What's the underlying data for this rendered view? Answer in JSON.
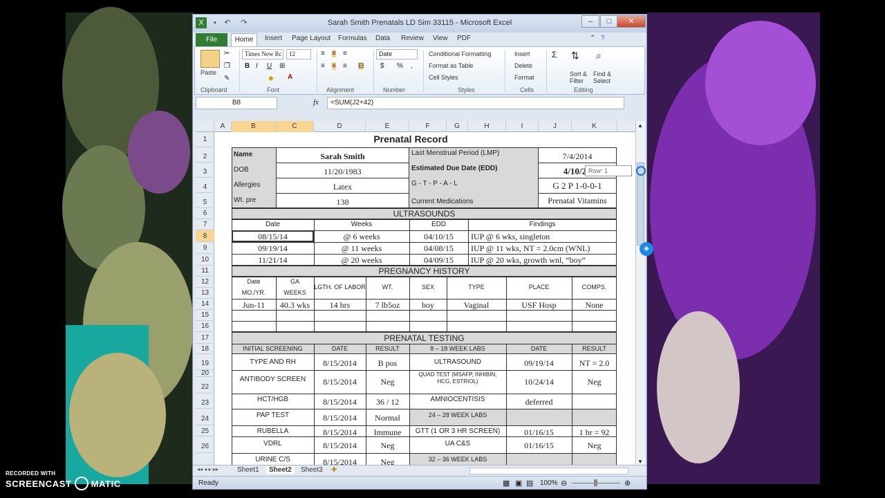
{
  "window": {
    "title": "Sarah Smith Prenatals LD Sim 33115  -  Microsoft Excel"
  },
  "tabs": [
    "File",
    "Home",
    "Insert",
    "Page Layout",
    "Formulas",
    "Data",
    "Review",
    "View",
    "PDF"
  ],
  "ribbon": {
    "clipboard": {
      "paste": "Paste",
      "group": "Clipboard"
    },
    "font": {
      "name": "Times New Rc",
      "size": "12",
      "group": "Font",
      "bold": "B",
      "italic": "I",
      "underline": "U"
    },
    "alignment": {
      "group": "Alignment"
    },
    "number": {
      "format": "Date",
      "currency": "$",
      "percent": "%",
      "comma": ",",
      "group": "Number"
    },
    "styles": {
      "conditional": "Conditional Formatting",
      "table": "Format as Table",
      "cell": "Cell Styles",
      "group": "Styles"
    },
    "cells": {
      "insert": "Insert",
      "delete": "Delete",
      "format": "Format",
      "group": "Cells"
    },
    "editing": {
      "sigma": "Σ",
      "sort1": "Sort &",
      "sort2": "Filter",
      "find1": "Find &",
      "find2": "Select",
      "group": "Editing"
    }
  },
  "formula_bar": {
    "name_box": "B8",
    "fx": "fx",
    "formula": "=SUM(J2+42)"
  },
  "columns": [
    "A",
    "B",
    "C",
    "D",
    "E",
    "F",
    "G",
    "H",
    "I",
    "J",
    "K"
  ],
  "rows": [
    "1",
    "2",
    "3",
    "4",
    "5",
    "6",
    "7",
    "8",
    "9",
    "10",
    "11",
    "12",
    "13",
    "14",
    "15",
    "16",
    "17",
    "18",
    "19",
    "20",
    "22",
    "23",
    "24",
    "25",
    "26"
  ],
  "sheet": {
    "title": "Prenatal Record",
    "name_label": "Name",
    "name_value": "Sarah Smith",
    "dob_label": "DOB",
    "dob_value": "11/20/1983",
    "allergies_label": "Allergies",
    "allergies_value": "Latex",
    "wt_label": "Wt. pre",
    "wt_value": "138",
    "lmp_label": "Last Menstrual Period  (LMP)",
    "lmp_value": "7/4/2014",
    "edd_label": "Estimated Due Date (EDD)",
    "edd_value": "4/10/2",
    "gtpal_label": "G - T - P - A - L",
    "gtpal_value": "G 2 P 1-0-0-1",
    "meds_label": "Current Medications",
    "meds_value": "Prenatal Vitamins",
    "ultrasounds": {
      "header": "ULTRASOUNDS",
      "columns": [
        "Date",
        "Weeks",
        "EDD",
        "Findings"
      ],
      "rows": [
        [
          "08/15/14",
          "@ 6 weeks",
          "04/10/15",
          "IUP @ 6 wks, singleton"
        ],
        [
          "09/19/14",
          "@ 11 weeks",
          "04/08/15",
          "IUP @ 11 wks, NT = 2.0cm (WNL)"
        ],
        [
          "11/21/14",
          "@ 20 weeks",
          "04/09/15",
          "IUP @ 20 wks, growth wnl, “boy”"
        ]
      ]
    },
    "pregnancy_history": {
      "header": "PREGNANCY HISTORY",
      "date_label1": "Date",
      "date_label2": "MO./YR.",
      "ga_label1": "GA",
      "ga_label2": "WEEKS",
      "labor_label": "LGTH. OF LABOR",
      "wt_label": "WT.",
      "sex_label": "SEX",
      "type_label": "TYPE",
      "place_label": "PLACE",
      "comps_label": "COMPS.",
      "row": [
        "Jun-11",
        "40.3 wks",
        "14 hrs",
        "7 lb5oz",
        "boy",
        "Vaginal",
        "USF Hosp",
        "None"
      ]
    },
    "prenatal_testing": {
      "header": "PRENATAL TESTING",
      "columns": [
        "INITIAL SCREENING",
        "DATE",
        "RESULT",
        "8 – 18 WEEK LABS",
        "DATE",
        "RESULT"
      ],
      "rows": [
        [
          "TYPE AND RH",
          "8/15/2014",
          "B pos",
          "ULTRASOUND",
          "09/19/14",
          "NT = 2.0"
        ],
        [
          "ANTIBODY SCREEN",
          "8/15/2014",
          "Neg",
          "QUAD TEST (MSAFP, INHIBIN, HCG, ESTRIOL)",
          "10/24/14",
          "Neg"
        ],
        [
          "HCT/HGB",
          "8/15/2014",
          "36 / 12",
          "AMNIOCENTISIS",
          "deferred",
          ""
        ],
        [
          "PAP TEST",
          "8/15/2014",
          "Normal",
          "24 – 28 WEEK LABS",
          "",
          ""
        ],
        [
          "RUBELLA",
          "8/15/2014",
          "Immune",
          "GTT (1 OR 3 HR SCREEN)",
          "01/16/15",
          "1 hr = 92"
        ],
        [
          "VDRL",
          "8/15/2014",
          "Neg",
          "UA C&S",
          "01/16/15",
          "Neg"
        ],
        [
          "URINE C/S",
          "8/15/2014",
          "Neg",
          "32 – 36 WEEK LABS",
          "",
          ""
        ]
      ]
    }
  },
  "tooltip": "Row: 1",
  "sheet_tabs": [
    "Sheet1",
    "Sheet2",
    "Sheet3"
  ],
  "status": {
    "ready": "Ready",
    "zoom": "100%"
  },
  "watermark": {
    "recorded": "RECORDED WITH",
    "brand1": "SCREENCAST",
    "brand2": "MATIC"
  }
}
